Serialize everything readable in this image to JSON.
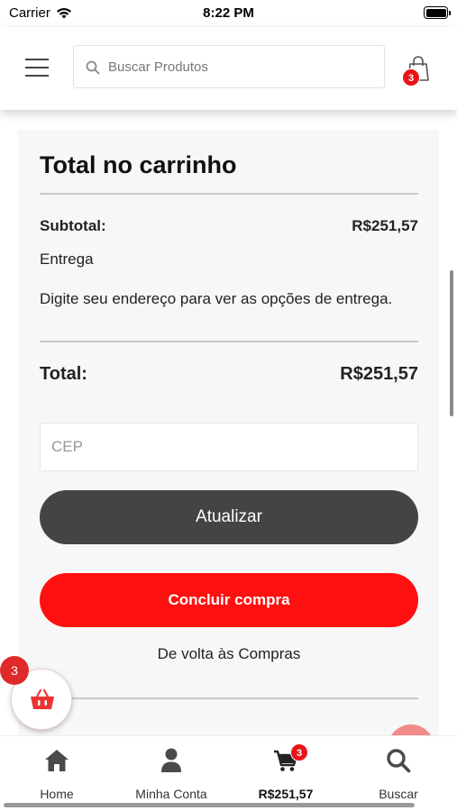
{
  "status_bar": {
    "carrier": "Carrier",
    "time": "8:22 PM",
    "icons": [
      "wifi-icon",
      "battery-icon"
    ]
  },
  "header": {
    "menu_icon": "hamburger-icon",
    "search": {
      "placeholder": "Buscar Produtos",
      "icon": "search-icon"
    },
    "cart": {
      "icon": "shopping-bag-icon",
      "count": "3"
    }
  },
  "cart_totals": {
    "title": "Total no carrinho",
    "subtotal_label": "Subtotal:",
    "subtotal_value": "R$251,57",
    "shipping_label": "Entrega",
    "shipping_note": "Digite seu endereço para ver as opções de entrega.",
    "total_label": "Total:",
    "total_value": "R$251,57",
    "cep_placeholder": "CEP",
    "update_button": "Atualizar",
    "checkout_button": "Concluir compra",
    "back_link": "De volta às Compras"
  },
  "floating_cart": {
    "icon": "basket-icon",
    "count": "3"
  },
  "tab_bar": {
    "items": [
      {
        "label": "Home",
        "icon": "home-icon"
      },
      {
        "label": "Minha Conta",
        "icon": "user-icon"
      },
      {
        "label": "R$251,57",
        "icon": "cart-icon",
        "badge": "3"
      },
      {
        "label": "Buscar",
        "icon": "search-icon"
      }
    ]
  },
  "colors": {
    "accent_red": "#ff1010",
    "badge_red": "#e8141a",
    "dark_button": "#444444",
    "card_bg": "#f7f7f7"
  }
}
